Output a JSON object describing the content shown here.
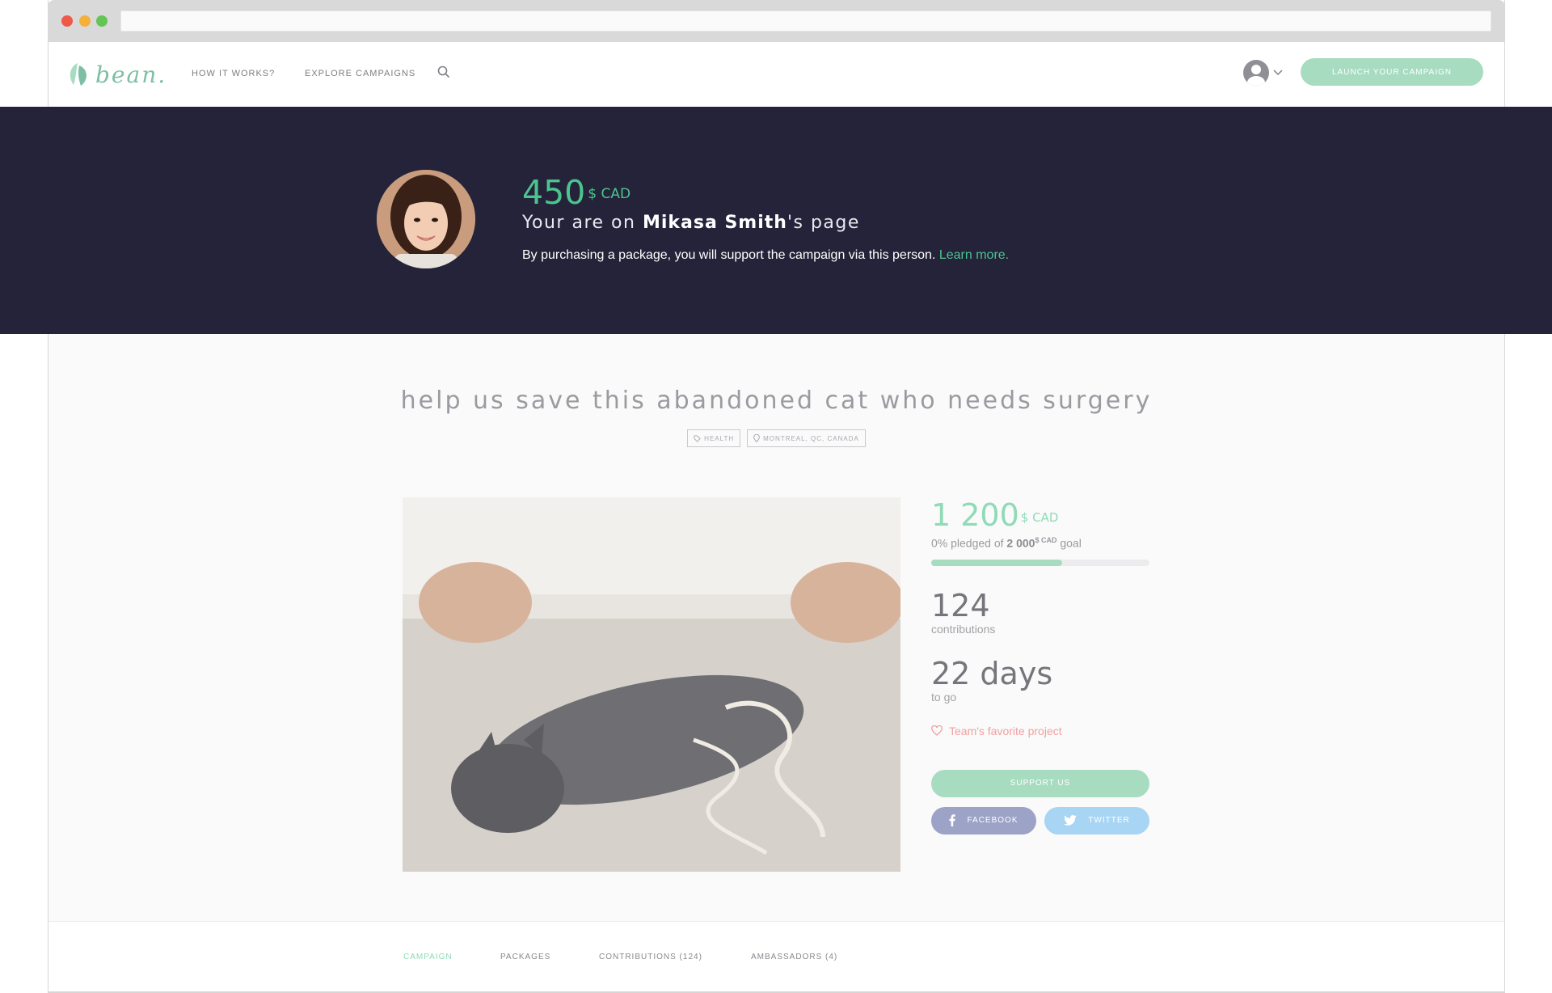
{
  "browser": {
    "window_controls": [
      "close",
      "minimize",
      "maximize"
    ],
    "url": ""
  },
  "header": {
    "logo_text": "bean.",
    "nav": {
      "how_it_works": "HOW IT WORKS?",
      "explore_campaigns": "EXPLORE CAMPAIGNS"
    },
    "search_icon": "search-icon",
    "launch_button": "LAUNCH YOUR CAMPAIGN",
    "colors": {
      "accent": "#a7dcc0"
    }
  },
  "ambassador": {
    "amount": "450",
    "currency": "$ CAD",
    "line_prefix": "Your are on ",
    "name": "Mikasa Smith",
    "line_suffix": "'s page",
    "description": "By purchasing a package, you will support the campaign via this person.",
    "learn_more": "Learn more.",
    "colors": {
      "background": "#24233a",
      "highlight": "#4cc48e"
    }
  },
  "campaign": {
    "title": "help us save this abandoned cat who needs surgery",
    "tags": [
      {
        "icon": "tag-icon",
        "label": "HEALTH"
      },
      {
        "icon": "location-pin-icon",
        "label": "MONTREAL, QC, CANADA"
      }
    ],
    "raised_amount": "1 200",
    "raised_currency": "$ CAD",
    "pledged_prefix": "0% pledged of ",
    "goal_amount": "2 000",
    "goal_currency": "$ CAD",
    "pledged_suffix": " goal",
    "progress_fraction": 0.6,
    "contributions_count": "124",
    "contributions_label": "contributions",
    "days_value": "22 days",
    "days_label": "to go",
    "favorite_label": "Team's favorite project",
    "support_button": "SUPPORT US",
    "share": {
      "facebook": "FACEBOOK",
      "twitter": "TWITTER"
    }
  },
  "tabs": {
    "campaign": "CAMPAIGN",
    "packages": "PACKAGES",
    "contributions": "CONTRIBUTIONS (124)",
    "ambassadors": "AMBASSADORS (4)",
    "active": "campaign"
  }
}
